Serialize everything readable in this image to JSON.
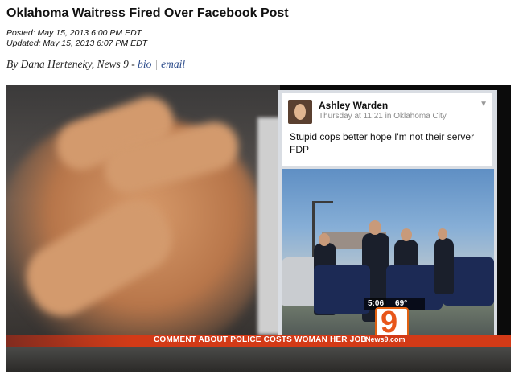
{
  "article": {
    "headline": "Oklahoma Waitress Fired Over Facebook Post",
    "posted": "Posted: May 15, 2013 6:00 PM EDT",
    "updated": "Updated: May 15, 2013 6:07 PM EDT",
    "byline_prefix": "By Dana Herteneky, News 9 -",
    "bio_link": "bio",
    "separator": "|",
    "email_link": "email"
  },
  "video": {
    "facebook_post": {
      "name": "Ashley Warden",
      "meta": "Thursday at 11:21 in Oklahoma City",
      "text": "Stupid cops better hope I'm not their server FDP"
    },
    "time": "5:06",
    "temperature": "69°",
    "station_number": "9",
    "ticker": "COMMENT ABOUT POLICE COSTS WOMAN HER JOB",
    "site": "News9.com"
  }
}
